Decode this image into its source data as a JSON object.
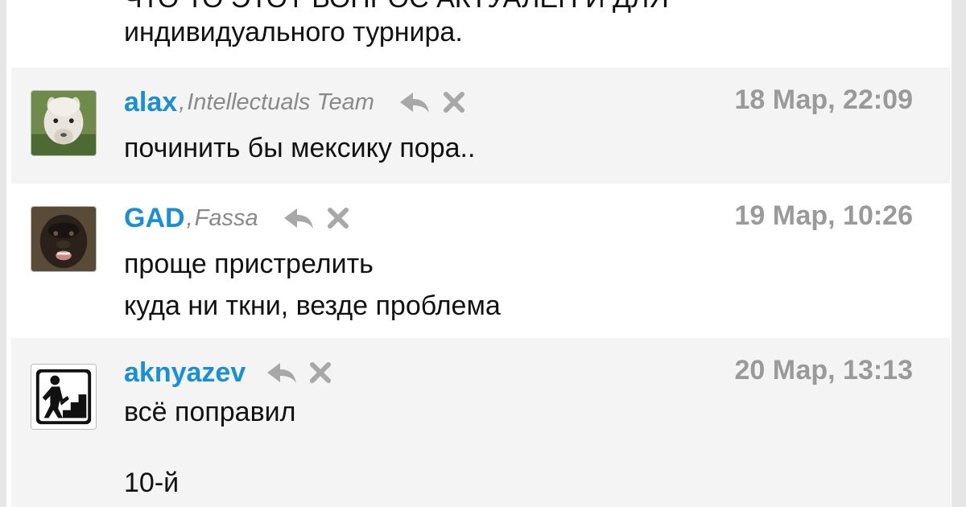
{
  "top_fragment": {
    "line1": "ЧТО ТО ЭТОТ ВОПРОС АКТУАЛЕН И ДЛЯ",
    "line2": "индивидуального турнира."
  },
  "comments": [
    {
      "author": "alax",
      "team_sep": ", ",
      "team": "Intellectuals Team",
      "date": "18 Мар, 22:09",
      "lines": [
        "починить бы мексику пора.."
      ],
      "avatar": "alpaca-avatar"
    },
    {
      "author": "GAD",
      "team_sep": ", ",
      "team": "Fassa",
      "date": "19 Мар, 10:26",
      "lines": [
        "проще пристрелить",
        "куда ни ткни, везде проблема"
      ],
      "avatar": "gorilla-avatar"
    },
    {
      "author": "aknyazev",
      "date": "20 Мар, 13:13",
      "lines": [
        "всё поправил",
        "",
        "10-й"
      ],
      "avatar": "stairs-climber-avatar"
    }
  ],
  "icons": {
    "reply": "reply-icon",
    "delete": "close-icon"
  },
  "colors": {
    "author": "#1a8fd6",
    "team": "#8a8a8a",
    "date": "#9a9a9a",
    "icon": "#a8a8a8",
    "row_shade": "#f4f4f4"
  }
}
